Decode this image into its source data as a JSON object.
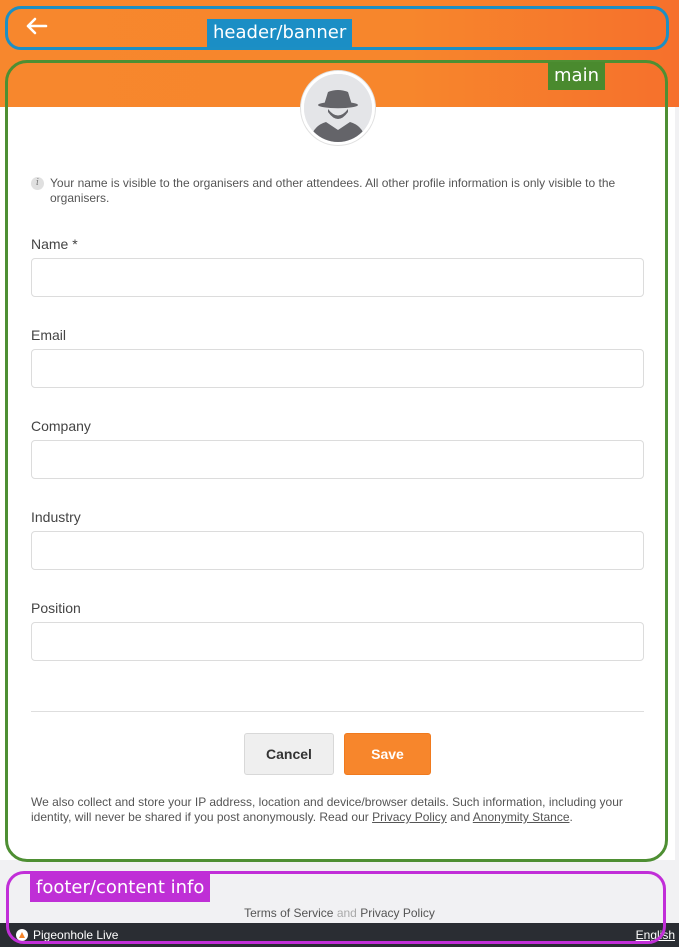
{
  "header": {
    "back_icon": "arrow-left-icon"
  },
  "profile": {
    "avatar_icon": "anonymous-avatar-icon",
    "info_icon": "info-icon",
    "info_text": "Your name is visible to the organisers and other attendees. All other profile information is only visible to the organisers."
  },
  "form": {
    "fields": [
      {
        "label": "Name *",
        "value": "",
        "placeholder": ""
      },
      {
        "label": "Email",
        "value": "",
        "placeholder": ""
      },
      {
        "label": "Company",
        "value": "",
        "placeholder": ""
      },
      {
        "label": "Industry",
        "value": "",
        "placeholder": ""
      },
      {
        "label": "Position",
        "value": "",
        "placeholder": ""
      }
    ],
    "cancel_label": "Cancel",
    "save_label": "Save"
  },
  "disclaimer": {
    "text_before": "We also collect and store your IP address, location and device/browser details. Such information, including your identity, will never be shared if you post anonymously. Read our ",
    "privacy_link": "Privacy Policy",
    "and_text": " and ",
    "anonymity_link": "Anonymity Stance",
    "text_after": "."
  },
  "footer": {
    "terms_link": "Terms of Service",
    "and_text": "and",
    "privacy_link": "Privacy Policy",
    "brand_icon": "pigeonhole-logo-icon",
    "brand_name": "Pigeonhole Live",
    "language": "English"
  },
  "annotations": {
    "header_label": "header/banner",
    "main_label": "main",
    "footer_label": "footer/content info"
  },
  "colors": {
    "brand_orange": "#f7862c",
    "header_annotation": "#1b8ec5",
    "main_annotation": "#4a8a2e",
    "footer_annotation": "#bf2fd6"
  }
}
